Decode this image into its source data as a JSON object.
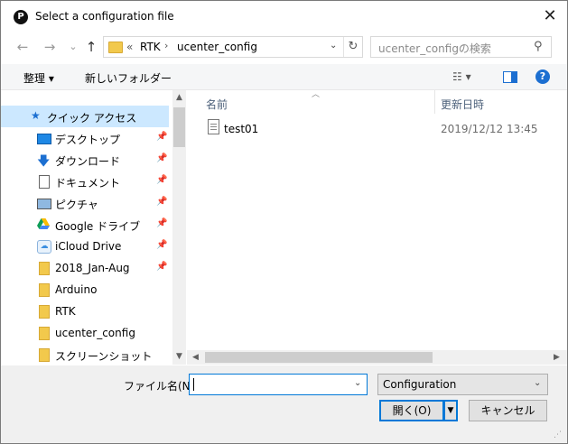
{
  "window": {
    "title": "Select a configuration file",
    "app_icon_letter": "P"
  },
  "nav": {
    "back_glyph": "←",
    "forward_glyph": "→",
    "dropdown_glyph": "⌄",
    "up_glyph": "↑"
  },
  "address": {
    "prefix": "«",
    "crumbs": [
      "RTK",
      "ucenter_config"
    ],
    "separator": "›",
    "refresh_glyph": "↻"
  },
  "search": {
    "placeholder": "ucenter_configの検索"
  },
  "toolbar": {
    "organize_label": "整理 ▾",
    "new_folder_label": "新しいフォルダー",
    "view_glyph": "☷ ▾",
    "pane_glyph": "▯",
    "help_glyph": "?"
  },
  "sidebar": {
    "items": [
      {
        "label": "クイック アクセス",
        "icon": "star-icon",
        "pinned": false,
        "selected": true
      },
      {
        "label": "デスクトップ",
        "icon": "desktop-icon",
        "pinned": true
      },
      {
        "label": "ダウンロード",
        "icon": "download-icon",
        "pinned": true
      },
      {
        "label": "ドキュメント",
        "icon": "document-icon",
        "pinned": true
      },
      {
        "label": "ピクチャ",
        "icon": "picture-icon",
        "pinned": true
      },
      {
        "label": "Google ドライブ",
        "icon": "google-drive-icon",
        "pinned": true
      },
      {
        "label": "iCloud Drive",
        "icon": "icloud-icon",
        "pinned": true
      },
      {
        "label": "2018_Jan-Aug",
        "icon": "folder-icon",
        "pinned": true
      },
      {
        "label": "Arduino",
        "icon": "folder-icon",
        "pinned": false
      },
      {
        "label": "RTK",
        "icon": "folder-icon",
        "pinned": false
      },
      {
        "label": "ucenter_config",
        "icon": "folder-icon",
        "pinned": false
      },
      {
        "label": "スクリーンショット",
        "icon": "folder-icon",
        "pinned": false
      }
    ],
    "pin_glyph": "📌"
  },
  "files": {
    "columns": [
      "名前",
      "更新日時"
    ],
    "rows": [
      {
        "name": "test01",
        "modified": "2019/12/12 13:45"
      }
    ]
  },
  "footer": {
    "filename_label": "ファイル名(N):",
    "filename_value": "",
    "filter_value": "Configuration",
    "open_label": "開く(O)",
    "cancel_label": "キャンセル"
  },
  "colors": {
    "selection": "#cce8ff",
    "accent": "#0078d7",
    "folder": "#f2c94c"
  }
}
